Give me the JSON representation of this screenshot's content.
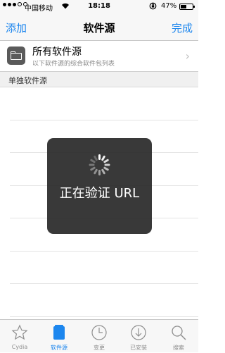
{
  "status_bar": {
    "carrier": "中国移动",
    "time": "18:18",
    "battery": "47%",
    "battery_level": 0.47
  },
  "nav": {
    "left": "添加",
    "title": "软件源",
    "right": "完成"
  },
  "all_sources": {
    "title": "所有软件源",
    "subtitle": "以下软件源的综合软件包列表"
  },
  "section": {
    "title": "单独软件源"
  },
  "hud": {
    "label": "正在验证 URL"
  },
  "tabs": [
    {
      "label": "Cydia",
      "icon": "star-icon",
      "active": false
    },
    {
      "label": "软件源",
      "icon": "sources-icon",
      "active": true
    },
    {
      "label": "变更",
      "icon": "clock-icon",
      "active": false
    },
    {
      "label": "已安装",
      "icon": "download-icon",
      "active": false
    },
    {
      "label": "搜索",
      "icon": "search-icon",
      "active": false
    }
  ],
  "colors": {
    "accent": "#1c86ee",
    "hud": "#282828"
  }
}
